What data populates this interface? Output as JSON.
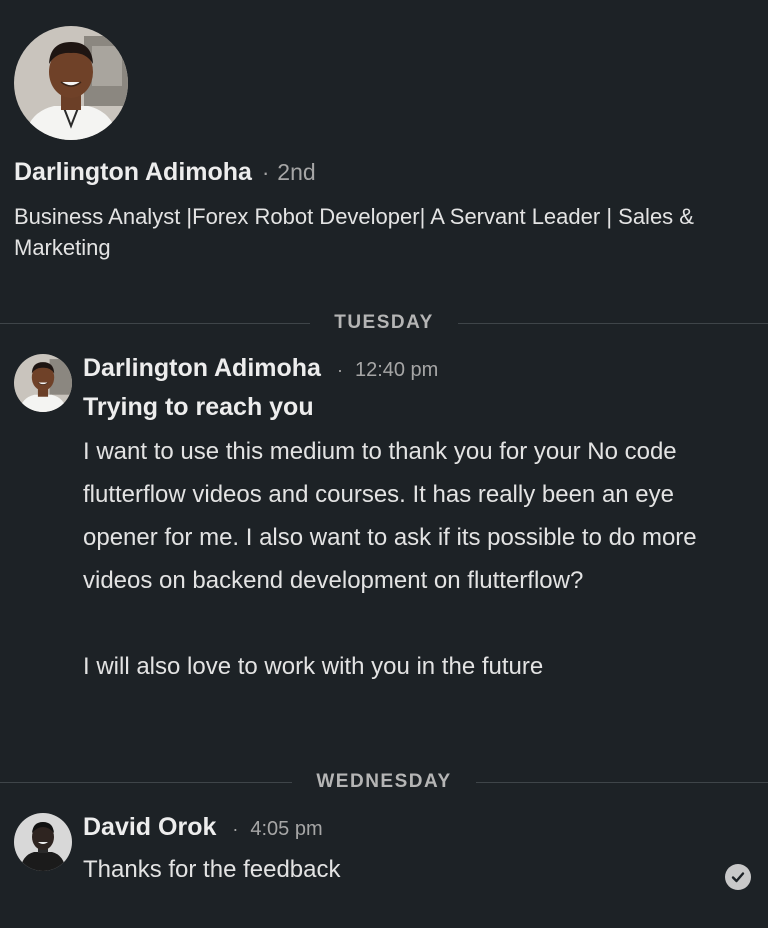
{
  "profile": {
    "name": "Darlington Adimoha",
    "separator": "·",
    "degree": "2nd",
    "headline": "Business Analyst |Forex Robot Developer| A Servant Leader | Sales & Marketing",
    "avatar_icon": "person-photo-icon"
  },
  "dividers": {
    "tuesday": "TUESDAY",
    "wednesday": "WEDNESDAY"
  },
  "messages": [
    {
      "sender": "Darlington Adimoha",
      "separator": "·",
      "time": "12:40 pm",
      "subject": "Trying to reach you",
      "paragraphs": [
        "I want to use this medium to thank you for your No code flutterflow videos and courses. It has really been an eye opener for me. I also want to ask if its possible to do more videos on backend development on flutterflow?",
        "I will also love to work with you in the future"
      ]
    },
    {
      "sender": "David Orok",
      "separator": "·",
      "time": "4:05 pm",
      "text": "Thanks for the feedback"
    }
  ],
  "colors": {
    "background": "#1d2226",
    "text_primary": "#ededed",
    "text_secondary": "#a6a6a6",
    "divider": "#3f4549"
  },
  "icons": {
    "read_receipt": "check-circle-icon"
  }
}
